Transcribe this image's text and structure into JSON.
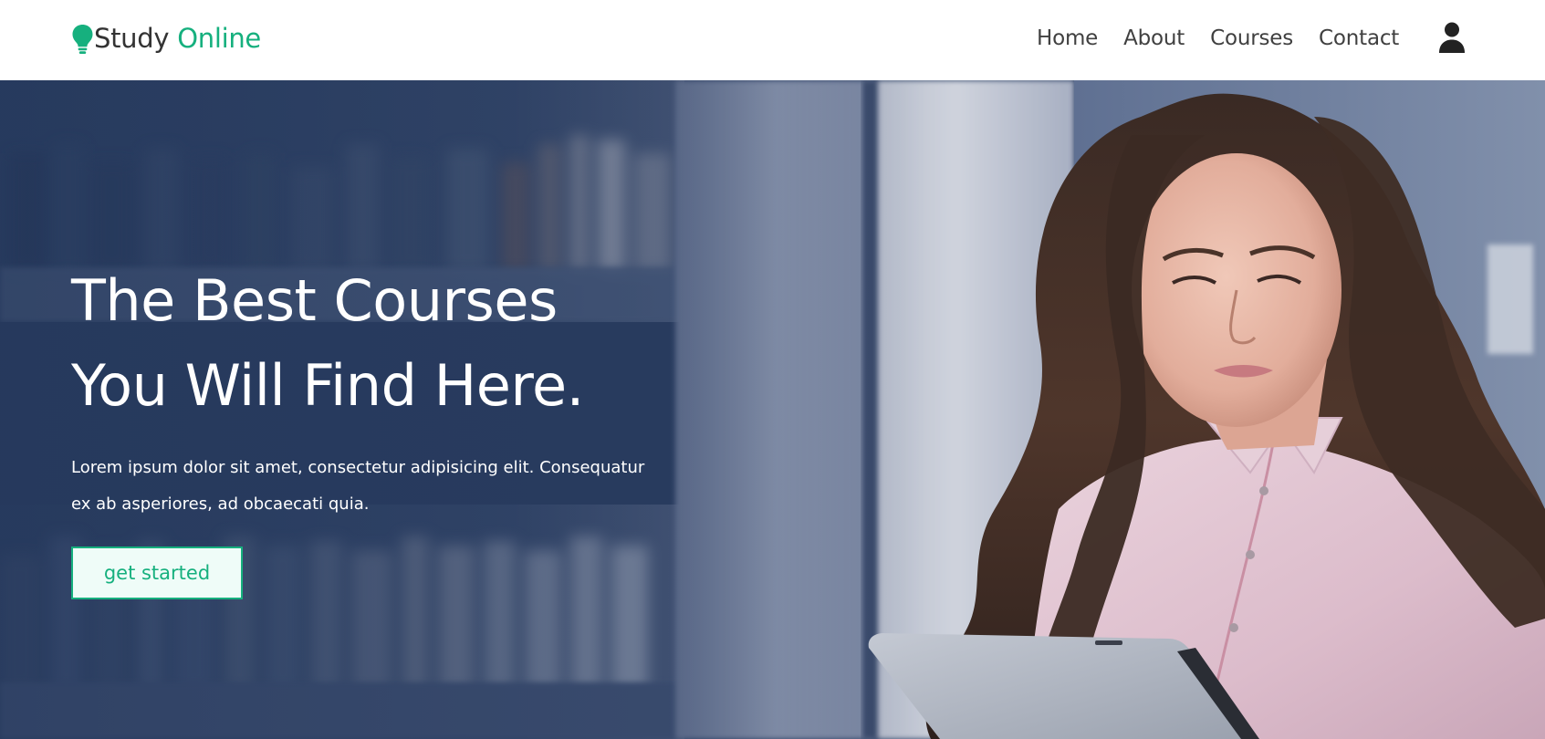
{
  "brand": {
    "name_part1": "Study",
    "name_part2": "Online",
    "accent_color": "#16b07e",
    "icon": "lightbulb-icon"
  },
  "nav": {
    "items": [
      {
        "label": "Home"
      },
      {
        "label": "About"
      },
      {
        "label": "Courses"
      },
      {
        "label": "Contact"
      }
    ],
    "user_icon": "user-icon"
  },
  "hero": {
    "title_line1": "The Best Courses",
    "title_line2": "You Will Find Here.",
    "text_line1": "Lorem ipsum dolor sit amet, consectetur adipisicing elit. Consequatur",
    "text_line2": "ex ab asperiores, ad obcaecati quia.",
    "cta_label": "get started",
    "overlay_color": "#2b3f62"
  }
}
